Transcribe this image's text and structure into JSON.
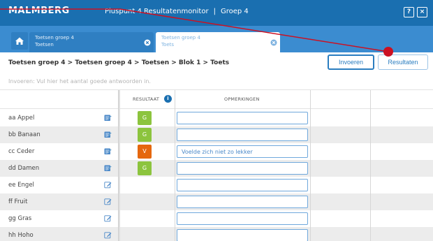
{
  "header": {
    "logo": "MALMBERG",
    "app_name": "Pluspunt 4 Resultatenmonitor",
    "separator": "|",
    "group": "Groep 4",
    "help_label": "?",
    "close_label": "×"
  },
  "tabs": [
    {
      "title": "Toetsen groep 4",
      "subtitle": "Toetsen"
    },
    {
      "title": "Toetsen groep 4",
      "subtitle": "Toets"
    }
  ],
  "breadcrumb": "Toetsen groep 4 > Toetsen groep 4 > Toetsen > Blok 1 > Toets",
  "buttons": {
    "invoeren": "Invoeren",
    "resultaten": "Resultaten"
  },
  "hint": "Invoeren: Vul hier het aantal goede antwoorden in.",
  "columns": {
    "resultaat": "RESULTAAT",
    "opmerkingen": "OPMERKINGEN",
    "info_label": "i"
  },
  "students": [
    {
      "name": "aa Appel",
      "result": "G",
      "remark": ""
    },
    {
      "name": "bb Banaan",
      "result": "G",
      "remark": ""
    },
    {
      "name": "cc Ceder",
      "result": "V",
      "remark": "Voelde zich niet zo lekker"
    },
    {
      "name": "dd Damen",
      "result": "G",
      "remark": ""
    },
    {
      "name": "ee Engel",
      "result": "",
      "remark": ""
    },
    {
      "name": "ff Fruit",
      "result": "",
      "remark": ""
    },
    {
      "name": "gg Gras",
      "result": "",
      "remark": ""
    },
    {
      "name": "hh Hoho",
      "result": "",
      "remark": ""
    }
  ],
  "colors": {
    "brand_blue": "#1a6fb0",
    "tab_blue": "#3b8cd0",
    "result_good": "#8cc43e",
    "result_insufficient": "#e5670e",
    "annotation_red": "#cc1122"
  },
  "icons": {
    "home": "home-icon",
    "tab_close": "close-circle-icon",
    "edit": "edit-note-icon",
    "info": "info-icon",
    "help": "help-icon",
    "close": "close-icon"
  }
}
